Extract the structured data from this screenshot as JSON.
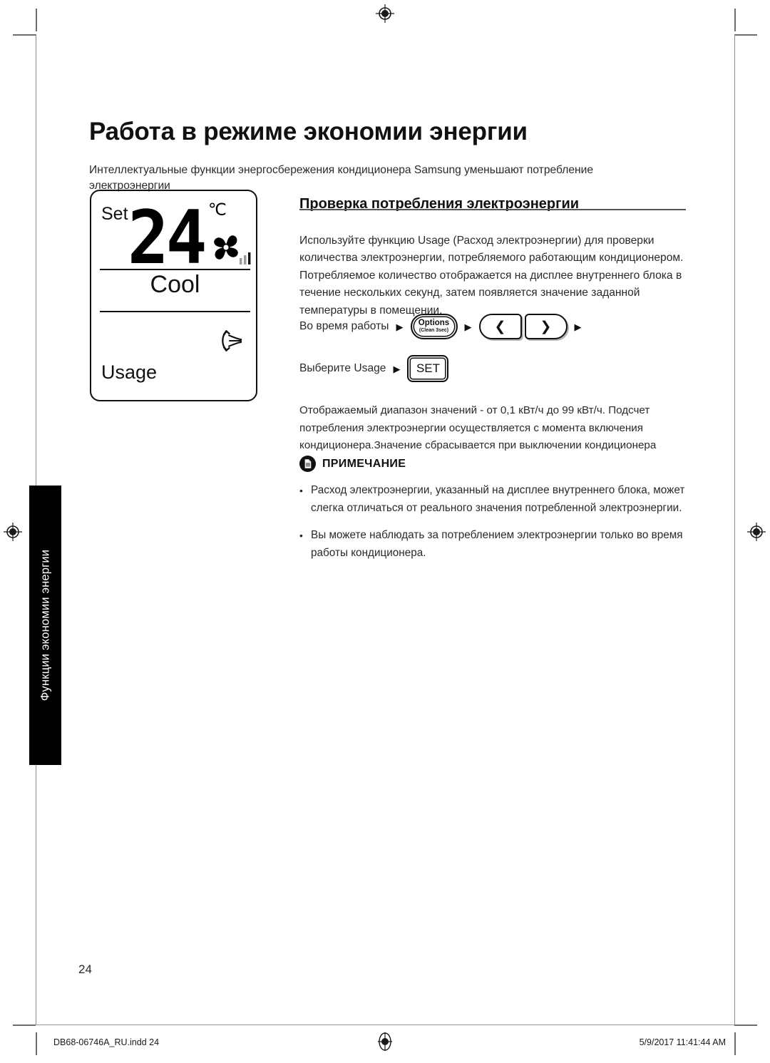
{
  "page": {
    "title": "Работа в режиме экономии энергии",
    "intro": "Интеллектуальные функции энергосбережения кондиционера Samsung уменьшают потребление электроэнергии",
    "number": "24"
  },
  "side_tab": {
    "label": "Функции экономии энергии"
  },
  "lcd": {
    "set_label": "Set",
    "temperature": "24",
    "degree_unit": "℃",
    "mode": "Cool",
    "usage_label": "Usage",
    "fan_icon": "pinwheel-fan-icon",
    "fan_level_icon": "signal-bars-icon",
    "swing_icon": "airflow-swing-icon"
  },
  "section": {
    "heading": "Проверка потребления электроэнергии",
    "paragraph_1": "Используйте функцию Usage (Расход электроэнергии) для проверки количества электроэнергии, потребляемого работающим кондиционером. Потребляемое количество отображается на дисплее внутреннего блока в течение нескольких секунд, затем появляется значение заданной температуры в помещении.",
    "paragraph_2": "Отображаемый диапазон значений - от 0,1 кВт/ч до 99 кВт/ч. Подсчет потребления электроэнергии осуществляется с момента включения кондиционера.Значение сбрасывается при выключении кондиционера"
  },
  "steps": [
    {
      "label": "Во время работы",
      "arrow": "▶",
      "options_button": {
        "main": "Options",
        "sub": "(Clean 3sec)"
      },
      "left_button": "❮",
      "right_button": "❯"
    },
    {
      "label": "Выберите Usage",
      "arrow": "▶",
      "set_button": "SET"
    }
  ],
  "note": {
    "icon": "document-note-icon",
    "heading": "ПРИМЕЧАНИЕ",
    "bullet": "•",
    "items": [
      "Расход электроэнергии, указанный на дисплее внутреннего блока, может слегка отличаться от реального значения потребленной электроэнергии.",
      "Вы можете наблюдать за потреблением электроэнергии только во время работы кондиционера."
    ]
  },
  "footer": {
    "file": "DB68-06746A_RU.indd   24",
    "timestamp": "5/9/2017   11:41:44 AM"
  },
  "colors": {
    "ink": "#111111",
    "body": "#2a2a2a",
    "tab_bg": "#000000",
    "rule": "#555555",
    "crop_mark": "#6e6e6e"
  }
}
